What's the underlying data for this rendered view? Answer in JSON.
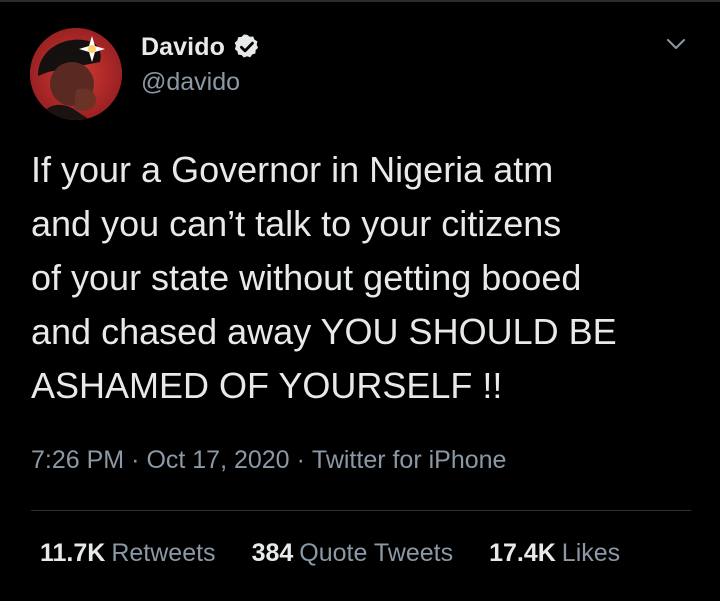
{
  "author": {
    "display_name": "Davido",
    "handle": "@davido",
    "verified": true,
    "avatar_icon": "profile-photo"
  },
  "tweet": {
    "text_lines": [
      "If your a Governor in Nigeria atm",
      "and you can’t talk to your citizens",
      "of your state without getting booed",
      "and chased away YOU SHOULD BE",
      "ASHAMED OF YOURSELF !!"
    ],
    "time": "7:26 PM",
    "date": "Oct 17, 2020",
    "source": "Twitter for iPhone",
    "separator": "·"
  },
  "stats": {
    "retweets": {
      "count": "11.7K",
      "label": "Retweets"
    },
    "quote_tweets": {
      "count": "384",
      "label": "Quote Tweets"
    },
    "likes": {
      "count": "17.4K",
      "label": "Likes"
    }
  },
  "colors": {
    "background": "#000000",
    "primary_text": "#e7e9ea",
    "secondary_text": "#8b98a5",
    "divider": "#2f3336",
    "verified_badge": "#e7e9ea"
  },
  "icons": {
    "verified": "verified-badge-icon",
    "menu": "chevron-down-icon"
  }
}
